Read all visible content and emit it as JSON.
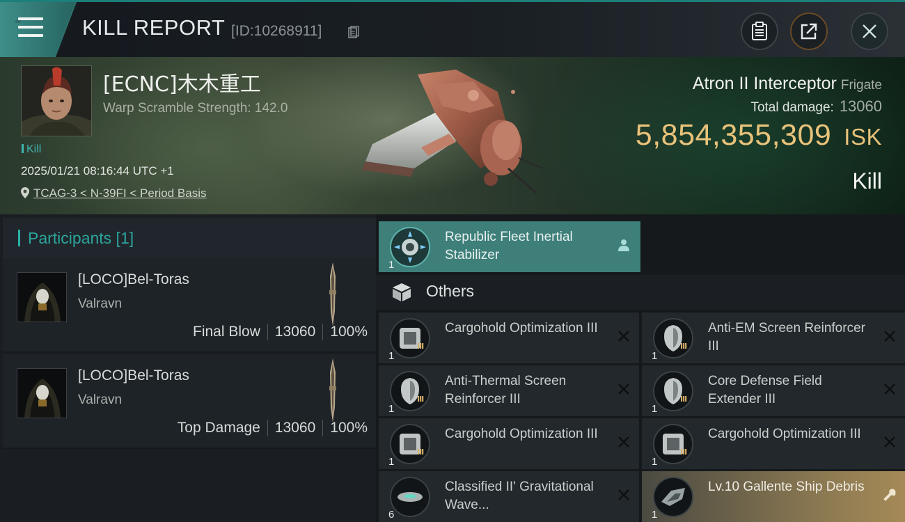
{
  "header": {
    "title": "KILL REPORT",
    "report_id": "[ID:10268911]",
    "buttons": [
      {
        "name": "clipboard-icon",
        "label": ""
      },
      {
        "name": "share-icon",
        "label": ""
      },
      {
        "name": "close-icon",
        "label": ""
      }
    ]
  },
  "victim": {
    "name": "[ECNC]木木重工",
    "warp_scramble_label": "Warp Scramble Strength: 142.0",
    "kill_tag": "Kill",
    "datetime": "2025/01/21 08:16:44 UTC +1",
    "location": "TCAG-3 < N-39FI < Period Basis"
  },
  "ship": {
    "name": "Atron II Interceptor",
    "class": "Frigate",
    "total_damage_label": "Total damage:",
    "total_damage_value": "13060",
    "isk_value": "5,854,355,309",
    "isk_unit": "ISK",
    "result": "Kill"
  },
  "participants": {
    "header": "Participants [1]",
    "rows": [
      {
        "name": "[LOCO]Bel-Toras",
        "ship": "Valravn",
        "role": "Final Blow",
        "damage": "13060",
        "percent": "100%"
      },
      {
        "name": "[LOCO]Bel-Toras",
        "ship": "Valravn",
        "role": "Top Damage",
        "damage": "13060",
        "percent": "100%"
      }
    ]
  },
  "items": {
    "top": {
      "name": "Republic Fleet Inertial Stabilizer",
      "qty": "1"
    },
    "others_label": "Others",
    "list": [
      {
        "name": "Cargohold Optimization III",
        "qty": "1",
        "tier": "III"
      },
      {
        "name": "Anti-EM Screen Reinforcer III",
        "qty": "1",
        "tier": "III"
      },
      {
        "name": "Anti-Thermal Screen Reinforcer III",
        "qty": "1",
        "tier": "III"
      },
      {
        "name": "Core Defense Field Extender III",
        "qty": "1",
        "tier": "III"
      },
      {
        "name": "Cargohold Optimization III",
        "qty": "1",
        "tier": "III"
      },
      {
        "name": "Cargohold Optimization III",
        "qty": "1",
        "tier": "III"
      },
      {
        "name": "Classified II' Gravitational Wave...",
        "qty": "6",
        "tier": ""
      },
      {
        "name": "Lv.10 Gallente Ship Debris",
        "qty": "1",
        "tier": ""
      }
    ]
  }
}
